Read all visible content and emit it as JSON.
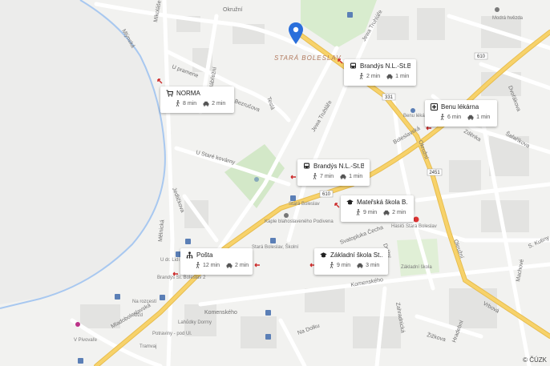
{
  "district": "STARÁ BOLESLAV",
  "copyright": "© ČÚZK",
  "streets": {
    "okruzni": "Okružní",
    "mlynska": "Mlýnská",
    "mikulase_ales": "Mikoláše Alše",
    "u_pramene": "U pramene",
    "nabrezni": "Nábřežní",
    "bezruca": "Bezručova",
    "tesla": "Teslá",
    "u_stare_kovarny": "U Staré kovárny",
    "jedlicka": "Jedličkova",
    "melnicka": "Mělnická",
    "jiraskova": "Jiráskova",
    "u_drcim": "U dr Lidí",
    "staroboleslavska": "Staroboleslavská",
    "mladoboleslavska": "Mladoboleslavská",
    "komenskeho": "Komenského",
    "komenskeho2": "Komenského",
    "na_dolku": "Na Dolku",
    "jewa_truhlare": "Jewa Truhláře",
    "boleslavska": "Boleslavská",
    "okruzni2": "Okružní",
    "zdenka": "Zděnka",
    "safarikova": "Šafaříkova",
    "dvorakova": "Dvořákova",
    "svatopluka_cecha": "Svatopluka Čecha",
    "drahy": "Dráhy",
    "zahradnicka": "Zahradnická",
    "zizkova": "Žižkova",
    "hradebni": "Hradební",
    "s_kutiny": "S. Kutiny",
    "machove": "Machové",
    "vrbova": "Vrbová"
  },
  "pois": {
    "hasici": "Hasiči Stará Boleslav",
    "zakladni_skola_map": "Základní škola",
    "kaple": "Kaple blahoslaveného Podivena",
    "stara_boleslav_stop": "Stará Boleslav",
    "stara_boleslav_skoli": "Stará Boleslav, Školní",
    "brandys_stop": "Brandýs St. Boleslav 2",
    "benu_map": "Benu lékárna",
    "na_rozcesti": "Na rozcestí",
    "ozd": "Ozd",
    "lahudky": "Lahůdky Dormy",
    "potraviny": "Potraviny - pod Ul.",
    "tramvaj": "Tramvaj",
    "v_pivovar": "V Pivovaře",
    "u_dr_lidi": "U dr. Lidí",
    "moda": "Modrá hvězda"
  },
  "road_numbers": [
    "610",
    "331",
    "2451",
    "610"
  ],
  "cards": [
    {
      "name": "NORMA",
      "icon": "cart-icon",
      "walk": "8 min",
      "car": "2 min"
    },
    {
      "name": "Brandýs N.L.-St.B...",
      "icon": "bus-icon",
      "walk": "2 min",
      "car": "1 min"
    },
    {
      "name": "Benu lékárna",
      "icon": "pharmacy-icon",
      "walk": "6 min",
      "car": "1 min"
    },
    {
      "name": "Brandýs N.L.-St.B...",
      "icon": "bus-icon",
      "walk": "7 min",
      "car": "1 min"
    },
    {
      "name": "Mateřská škola B...",
      "icon": "school-icon",
      "walk": "9 min",
      "car": "2 min"
    },
    {
      "name": "Pošta",
      "icon": "post-icon",
      "walk": "12 min",
      "car": "2 min"
    },
    {
      "name": "Základní škola St...",
      "icon": "school-icon",
      "walk": "9 min",
      "car": "3 min"
    }
  ],
  "colors": {
    "background": "#f2f2f0",
    "river": "#a8c8f0",
    "park": "#d3e8c8",
    "major_road": "#f7d26a",
    "pin": "#2a6fdb",
    "arrow": "#cc2a2a"
  }
}
